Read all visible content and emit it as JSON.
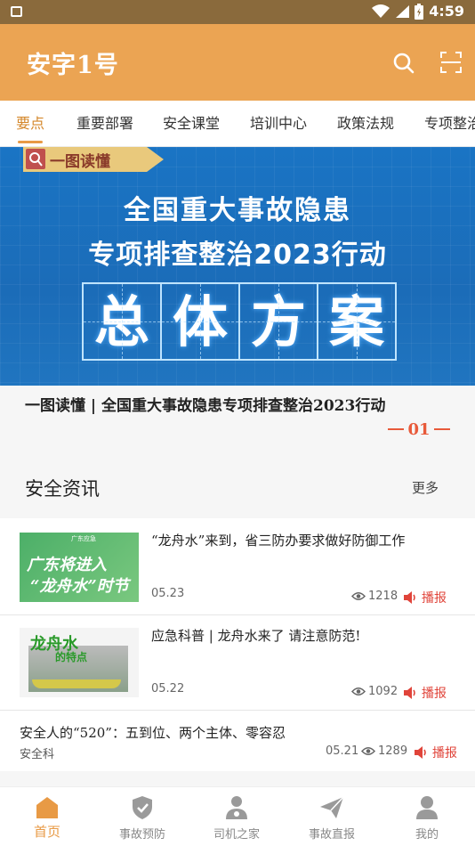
{
  "status_bar": {
    "time": "4:59"
  },
  "app": {
    "title": "安字1号"
  },
  "tabs": [
    "要点",
    "重要部署",
    "安全课堂",
    "培训中心",
    "政策法规",
    "专项整治"
  ],
  "banner": {
    "tag": "一图读懂",
    "line1": "全国重大事故隐患",
    "line2": "专项排查整治2023行动",
    "big_chars": [
      "总",
      "体",
      "方",
      "案"
    ],
    "caption": "一图读懂 | 全国重大事故隐患专项排查整治2023行动",
    "index": "01"
  },
  "section": {
    "title": "安全资讯",
    "more": "更多"
  },
  "news": [
    {
      "headline": "“龙舟水”来到，省三防办要求做好防御工作",
      "date": "05.23",
      "views": "1218",
      "play_label": "播报",
      "thumb_text1": "广东将进入",
      "thumb_text2": "“龙舟水”时节",
      "thumb_logo": "广东应急"
    },
    {
      "headline": "应急科普 | 龙舟水来了 请注意防范!",
      "date": "05.22",
      "views": "1092",
      "play_label": "播报",
      "thumb_text1": "龙舟水",
      "thumb_text2": "的特点"
    },
    {
      "headline": "安全人的“520”：五到位、两个主体、零容忍",
      "source": "安全科",
      "date": "05.21",
      "views": "1289",
      "play_label": "播报"
    }
  ],
  "bottom_nav": [
    {
      "label": "首页",
      "icon": "home-icon",
      "active": true
    },
    {
      "label": "事故预防",
      "icon": "shield-icon",
      "active": false
    },
    {
      "label": "司机之家",
      "icon": "driver-icon",
      "active": false
    },
    {
      "label": "事故直报",
      "icon": "send-icon",
      "active": false
    },
    {
      "label": "我的",
      "icon": "person-icon",
      "active": false
    }
  ],
  "colors": {
    "primary": "#EBA453",
    "accent_red": "#E0443A",
    "banner_blue": "#1B6CB8"
  }
}
